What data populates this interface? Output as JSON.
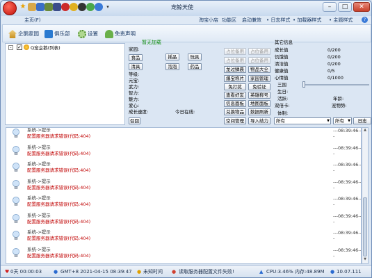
{
  "window": {
    "title": "宠鲸天使"
  },
  "menubar": {
    "home_tab": "主页(F)",
    "items": [
      "淘宝小店",
      "功能区",
      "启动兼效",
      "• 日志样式",
      "• 加载器样式",
      "• 主题样式"
    ]
  },
  "toolbar": {
    "items": [
      {
        "label": "企鹅家园",
        "icon": "home-icon"
      },
      {
        "label": "俱乐部",
        "icon": "club-icon"
      },
      {
        "label": "设置",
        "icon": "gear-icon"
      },
      {
        "label": "免责声明",
        "icon": "disclaimer-icon"
      }
    ]
  },
  "account_list": {
    "item_label": "Q宠企鹅(列表)"
  },
  "pet": {
    "status_title": "暂无加载",
    "home_label": "家园:",
    "home_buttons": [
      "食品",
      "摇晶",
      "玩具",
      "清具",
      "泡泡",
      "药品"
    ],
    "stats_labels": [
      "等级:",
      "元宝:",
      "武力:",
      "智力:",
      "魅力:",
      "爱心:",
      "成长速度:"
    ],
    "online_label": "今日在线:",
    "recall_button": "召回"
  },
  "actions": {
    "buttons": [
      {
        "label": "占位备用",
        "disabled": true
      },
      {
        "label": "占位备用",
        "disabled": true
      },
      {
        "label": "占位备用",
        "disabled": true
      },
      {
        "label": "占位备用",
        "disabled": true
      },
      {
        "label": "龙过鳞晨",
        "disabled": false
      },
      {
        "label": "物品大全",
        "disabled": false
      },
      {
        "label": "爆宝称片",
        "disabled": false
      },
      {
        "label": "家园管理",
        "disabled": false
      },
      {
        "label": "免打扰",
        "disabled": false
      },
      {
        "label": "免验证",
        "disabled": false
      },
      {
        "label": "查看好友",
        "disabled": false
      },
      {
        "label": "英雄称号",
        "disabled": false
      },
      {
        "label": "信息面板",
        "disabled": false
      },
      {
        "label": "地图面板",
        "disabled": false
      },
      {
        "label": "兑换物品",
        "disabled": false
      },
      {
        "label": "数据刷新",
        "disabled": false
      },
      {
        "label": "空间管理",
        "disabled": false
      },
      {
        "label": "导入结力",
        "disabled": false
      }
    ],
    "select_value": "所有"
  },
  "other_info": {
    "title": "其它信息",
    "rows": [
      {
        "label": "成长值",
        "value": "0/200"
      },
      {
        "label": "饥饿值",
        "value": "0/200"
      },
      {
        "label": "清洁值",
        "value": "0/200"
      },
      {
        "label": "健康值",
        "value": "0/5"
      },
      {
        "label": "心情值",
        "value": "0/1000"
      }
    ],
    "extra_labels": [
      "三围",
      "生日:",
      "活跃:",
      "双倍卡:",
      "体制:"
    ],
    "age_label": "年龄:",
    "pet_object_label": "宠物势:",
    "select_value": "所有",
    "log_button": "日志"
  },
  "log": {
    "entries": [
      {
        "title": "系统->提示",
        "message": "配置服务器请求错误(代码:404)",
        "time": "---08:39:46---"
      },
      {
        "title": "系统->提示",
        "message": "配置服务器请求错误(代码:404)",
        "time": "---08:39:46---"
      },
      {
        "title": "系统->提示",
        "message": "配置服务器请求错误(代码:404)",
        "time": "---08:39:46---"
      },
      {
        "title": "系统->提示",
        "message": "配置服务器请求错误(代码:404)",
        "time": "---08:39:46---"
      },
      {
        "title": "系统->提示",
        "message": "配置服务器请求错误(代码:404)",
        "time": "---08:39:46---"
      },
      {
        "title": "系统->提示",
        "message": "配置服务器请求错误(代码:404)",
        "time": "---08:39:46---"
      },
      {
        "title": "系统->提示",
        "message": "配置服务器请求错误(代码:404)",
        "time": "---08:39:46---"
      },
      {
        "title": "系统->提示",
        "message": "配置服务器请求错误(代码:404)",
        "time": "---08:39:46---"
      }
    ]
  },
  "statusbar": {
    "uptime": "0天 00:00:03",
    "datetime": "GMT+8 2021-04-15 08:39:47",
    "sync": "未知时间",
    "message": "读取服务器配置文件失败!",
    "resources": "CPU:3.46% 内存:48.89M",
    "version": "10.07.111"
  },
  "colors": {
    "accent": "#1b3a66",
    "error": "#c00000",
    "pet_title": "#0a8a0a"
  }
}
